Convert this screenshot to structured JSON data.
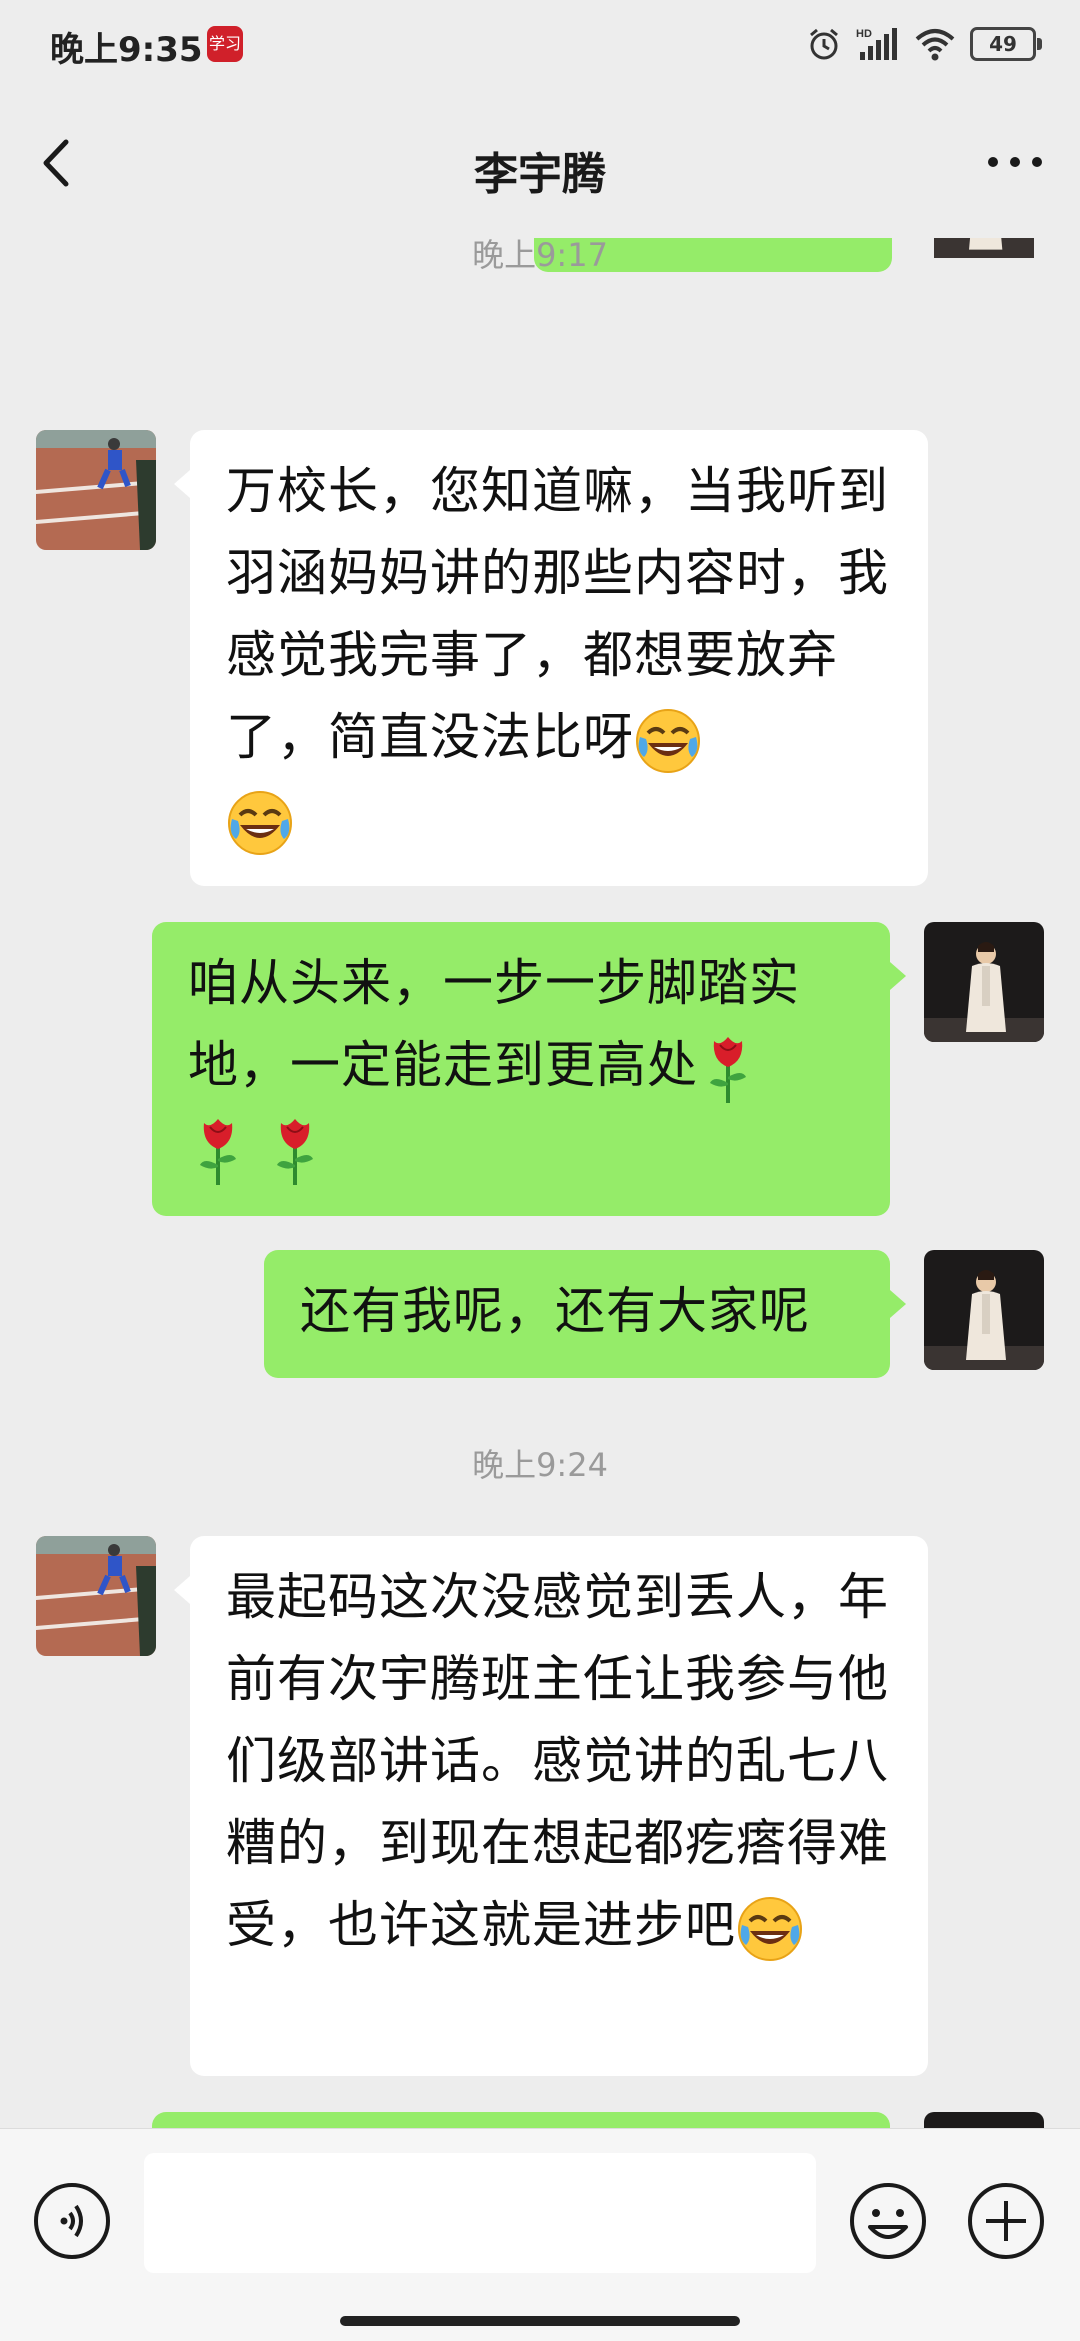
{
  "status_bar": {
    "time": "晚上9:35",
    "app_badge": "学习",
    "network": "HD",
    "battery": "49"
  },
  "header": {
    "title": "李宇腾"
  },
  "messages": {
    "ts1": "晚上9:17",
    "m1_text": "万校长，您知道嘛，当我听到羽涵妈妈讲的那些内容时，我感觉我完事了，都想要放弃了，简直没法比呀",
    "m2_text": "咱从头来，一步一步脚踏实地，一定能走到更高处",
    "m3_text": "还有我呢，还有大家呢",
    "ts2": "晚上9:24",
    "m4_text": "最起码这次没感觉到丢人，年前有次宇腾班主任让我参与他们级部讲话。感觉讲的乱七八糟的，到现在想起都疙瘩得难受，也许这就是进步吧"
  },
  "colors": {
    "background": "#EDEDED",
    "bubble_in": "#FFFFFF",
    "bubble_out": "#95EC69",
    "timestamp": "#9A9A9A"
  },
  "icons": [
    "back-icon",
    "more-icon",
    "voice-icon",
    "emoji-icon",
    "plus-icon",
    "alarm-icon",
    "signal-icon",
    "wifi-icon",
    "battery-icon",
    "cry-laugh-emoji",
    "rose-emoji"
  ]
}
